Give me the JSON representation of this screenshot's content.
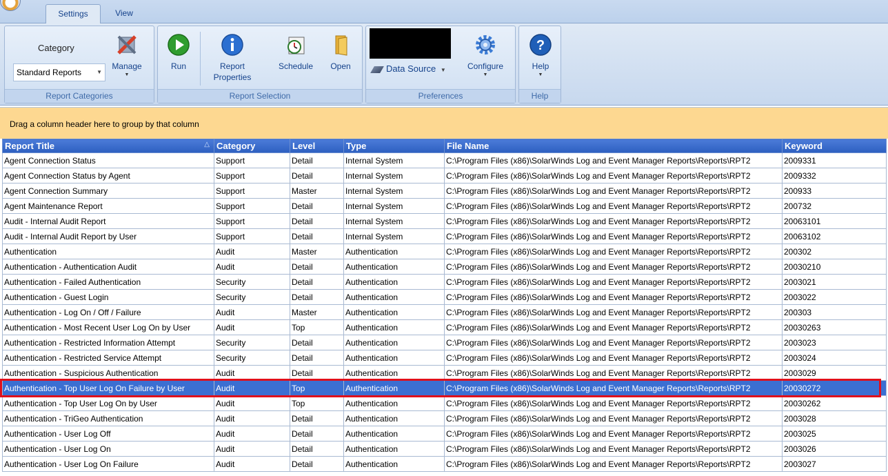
{
  "tabs": [
    {
      "label": "Settings",
      "active": true
    },
    {
      "label": "View",
      "active": false
    }
  ],
  "ribbon": {
    "report_categories": {
      "group_label": "Report Categories",
      "category_label": "Category",
      "category_value": "Standard Reports",
      "manage_label": "Manage"
    },
    "report_selection": {
      "group_label": "Report Selection",
      "run_label": "Run",
      "properties_label_1": "Report",
      "properties_label_2": "Properties",
      "schedule_label": "Schedule",
      "open_label": "Open"
    },
    "preferences": {
      "group_label": "Preferences",
      "data_source_label": "Data Source",
      "configure_label": "Configure"
    },
    "help": {
      "group_label": "Help",
      "help_label": "Help"
    }
  },
  "group_bar_text": "Drag a column header here to group by that column",
  "columns": [
    "Report Title",
    "Category",
    "Level",
    "Type",
    "File Name",
    "Keyword"
  ],
  "rows": [
    [
      "Agent Connection Status",
      "Support",
      "Detail",
      "Internal System",
      "C:\\Program Files (x86)\\SolarWinds Log and Event Manager Reports\\Reports\\RPT2",
      "2009331"
    ],
    [
      "Agent Connection Status by Agent",
      "Support",
      "Detail",
      "Internal System",
      "C:\\Program Files (x86)\\SolarWinds Log and Event Manager Reports\\Reports\\RPT2",
      "2009332"
    ],
    [
      "Agent Connection Summary",
      "Support",
      "Master",
      "Internal System",
      "C:\\Program Files (x86)\\SolarWinds Log and Event Manager Reports\\Reports\\RPT2",
      "200933"
    ],
    [
      "Agent Maintenance Report",
      "Support",
      "Detail",
      "Internal System",
      "C:\\Program Files (x86)\\SolarWinds Log and Event Manager Reports\\Reports\\RPT2",
      "200732"
    ],
    [
      "Audit - Internal Audit Report",
      "Support",
      "Detail",
      "Internal System",
      "C:\\Program Files (x86)\\SolarWinds Log and Event Manager Reports\\Reports\\RPT2",
      "20063101"
    ],
    [
      "Audit - Internal Audit Report by User",
      "Support",
      "Detail",
      "Internal System",
      "C:\\Program Files (x86)\\SolarWinds Log and Event Manager Reports\\Reports\\RPT2",
      "20063102"
    ],
    [
      "Authentication",
      "Audit",
      "Master",
      "Authentication",
      "C:\\Program Files (x86)\\SolarWinds Log and Event Manager Reports\\Reports\\RPT2",
      "200302"
    ],
    [
      "Authentication - Authentication Audit",
      "Audit",
      "Detail",
      "Authentication",
      "C:\\Program Files (x86)\\SolarWinds Log and Event Manager Reports\\Reports\\RPT2",
      "20030210"
    ],
    [
      "Authentication - Failed Authentication",
      "Security",
      "Detail",
      "Authentication",
      "C:\\Program Files (x86)\\SolarWinds Log and Event Manager Reports\\Reports\\RPT2",
      "2003021"
    ],
    [
      "Authentication - Guest Login",
      "Security",
      "Detail",
      "Authentication",
      "C:\\Program Files (x86)\\SolarWinds Log and Event Manager Reports\\Reports\\RPT2",
      "2003022"
    ],
    [
      "Authentication - Log On / Off / Failure",
      "Audit",
      "Master",
      "Authentication",
      "C:\\Program Files (x86)\\SolarWinds Log and Event Manager Reports\\Reports\\RPT2",
      "200303"
    ],
    [
      "Authentication - Most Recent User Log On by User",
      "Audit",
      "Top",
      "Authentication",
      "C:\\Program Files (x86)\\SolarWinds Log and Event Manager Reports\\Reports\\RPT2",
      "20030263"
    ],
    [
      "Authentication - Restricted Information Attempt",
      "Security",
      "Detail",
      "Authentication",
      "C:\\Program Files (x86)\\SolarWinds Log and Event Manager Reports\\Reports\\RPT2",
      "2003023"
    ],
    [
      "Authentication - Restricted Service Attempt",
      "Security",
      "Detail",
      "Authentication",
      "C:\\Program Files (x86)\\SolarWinds Log and Event Manager Reports\\Reports\\RPT2",
      "2003024"
    ],
    [
      "Authentication - Suspicious Authentication",
      "Audit",
      "Detail",
      "Authentication",
      "C:\\Program Files (x86)\\SolarWinds Log and Event Manager Reports\\Reports\\RPT2",
      "2003029"
    ],
    [
      "Authentication - Top User Log On Failure by User",
      "Audit",
      "Top",
      "Authentication",
      "C:\\Program Files (x86)\\SolarWinds Log and Event Manager Reports\\Reports\\RPT2",
      "20030272"
    ],
    [
      "Authentication - Top User Log On by User",
      "Audit",
      "Top",
      "Authentication",
      "C:\\Program Files (x86)\\SolarWinds Log and Event Manager Reports\\Reports\\RPT2",
      "20030262"
    ],
    [
      "Authentication - TriGeo Authentication",
      "Audit",
      "Detail",
      "Authentication",
      "C:\\Program Files (x86)\\SolarWinds Log and Event Manager Reports\\Reports\\RPT2",
      "2003028"
    ],
    [
      "Authentication - User Log Off",
      "Audit",
      "Detail",
      "Authentication",
      "C:\\Program Files (x86)\\SolarWinds Log and Event Manager Reports\\Reports\\RPT2",
      "2003025"
    ],
    [
      "Authentication - User Log On",
      "Audit",
      "Detail",
      "Authentication",
      "C:\\Program Files (x86)\\SolarWinds Log and Event Manager Reports\\Reports\\RPT2",
      "2003026"
    ],
    [
      "Authentication - User Log On Failure",
      "Audit",
      "Detail",
      "Authentication",
      "C:\\Program Files (x86)\\SolarWinds Log and Event Manager Reports\\Reports\\RPT2",
      "2003027"
    ]
  ],
  "selected_row_index": 15,
  "colors": {
    "header_bg": "#2d5fc0",
    "selected_row_bg": "#3b6fd2",
    "group_bar_bg": "#fdd891",
    "highlight_border": "#e0101c"
  }
}
